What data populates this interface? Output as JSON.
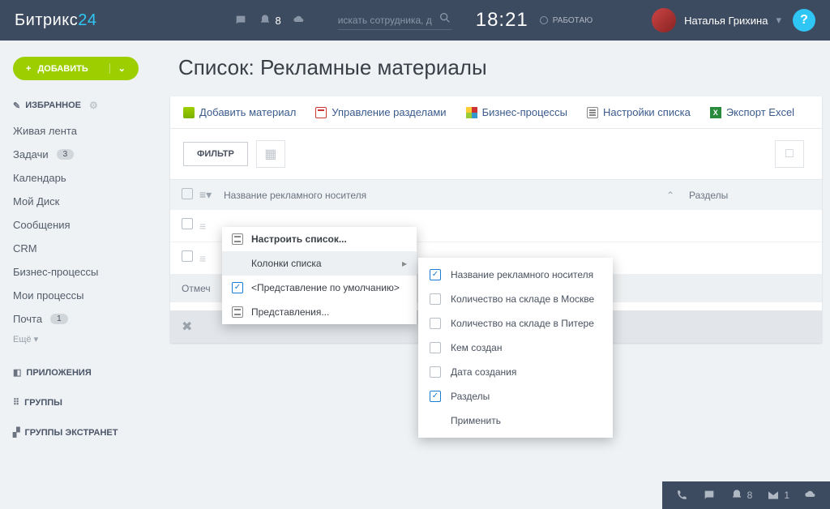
{
  "header": {
    "logo1": "Битрикс",
    "logo2": "24",
    "notif": "8",
    "searchPh": "искать сотрудника, д",
    "clock": "18:21",
    "status": "РАБОТАЮ",
    "user": "Наталья Грихина",
    "help": "?"
  },
  "sidebar": {
    "addBtn": "ДОБАВИТЬ",
    "fav": "ИЗБРАННОЕ",
    "items": [
      {
        "label": "Живая лента"
      },
      {
        "label": "Задачи",
        "badge": "3"
      },
      {
        "label": "Календарь"
      },
      {
        "label": "Мой Диск"
      },
      {
        "label": "Сообщения"
      },
      {
        "label": "CRM"
      },
      {
        "label": "Бизнес-процессы"
      },
      {
        "label": "Мои процессы"
      },
      {
        "label": "Почта",
        "badge": "1"
      }
    ],
    "more": "Ещё",
    "apps": "ПРИЛОЖЕНИЯ",
    "groups": "ГРУППЫ",
    "extranet": "ГРУППЫ ЭКСТРАНЕТ"
  },
  "page": {
    "title": "Список: Рекламные материалы"
  },
  "toolbar": {
    "add": "Добавить материал",
    "sections": "Управление разделами",
    "bp": "Бизнес-процессы",
    "settings": "Настройки списка",
    "export": "Экспорт Excel"
  },
  "filter": {
    "label": "ФИЛЬТР"
  },
  "table": {
    "hdName": "Название рекламного носителя",
    "hdSec": "Разделы",
    "markRow": "Отмеч"
  },
  "ctx1": {
    "configure": "Настроить список...",
    "columns": "Колонки списка",
    "defaultView": "<Представление по умолчанию>",
    "views": "Представления..."
  },
  "ctx2": {
    "items": [
      {
        "label": "Название рекламного носителя",
        "checked": true
      },
      {
        "label": "Количество на складе в Москве",
        "checked": false
      },
      {
        "label": "Количество на складе в Питере",
        "checked": false
      },
      {
        "label": "Кем создан",
        "checked": false
      },
      {
        "label": "Дата создания",
        "checked": false
      },
      {
        "label": "Разделы",
        "checked": true
      }
    ],
    "apply": "Применить"
  },
  "footer": {
    "bell": "8",
    "mail": "1"
  }
}
